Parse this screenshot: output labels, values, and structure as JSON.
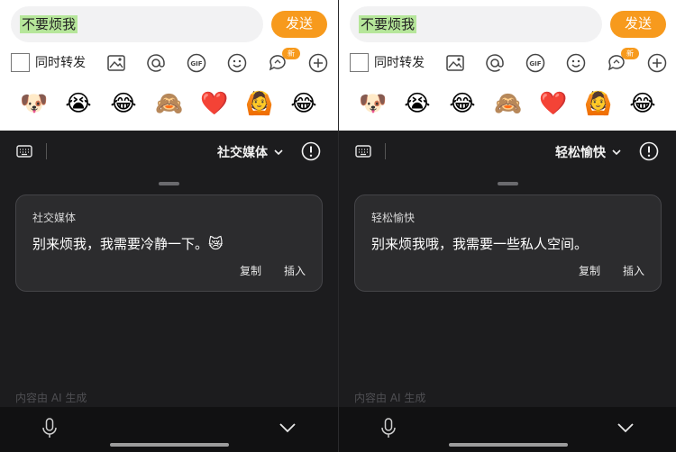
{
  "panels": [
    {
      "input_text": "不要烦我",
      "send_label": "发送",
      "repost_label": "同时转发",
      "new_badge": "新",
      "emojis": [
        "🐶",
        "😭",
        "😂",
        "🙈",
        "❤️",
        "🙆",
        "😂"
      ],
      "style_label": "社交媒体",
      "card": {
        "title": "社交媒体",
        "text": "别来烦我，我需要冷静一下。",
        "emoji": "😿",
        "copy_label": "复制",
        "insert_label": "插入"
      },
      "ai_note": "内容由 AI 生成"
    },
    {
      "input_text": "不要烦我",
      "send_label": "发送",
      "repost_label": "同时转发",
      "new_badge": "新",
      "emojis": [
        "🐶",
        "😭",
        "😂",
        "🙈",
        "❤️",
        "🙆",
        "😂"
      ],
      "style_label": "轻松愉快",
      "card": {
        "title": "轻松愉快",
        "text": "别来烦我哦，我需要一些私人空间。",
        "emoji": "",
        "copy_label": "复制",
        "insert_label": "插入"
      },
      "ai_note": "内容由 AI 生成"
    }
  ],
  "icons": {
    "image": "image-icon",
    "at": "at-icon",
    "gif": "gif-icon",
    "emoji": "smile-icon",
    "topic": "topic-chat-icon",
    "add": "plus-circle-icon",
    "keyboard": "keyboard-icon",
    "info": "info-icon",
    "mic": "mic-icon",
    "collapse": "chevron-down-icon"
  },
  "colors": {
    "accent": "#f79a1d",
    "highlight": "#b6e69a",
    "dark_bg": "#1c1c1e",
    "card_bg": "#2c2c2e"
  }
}
